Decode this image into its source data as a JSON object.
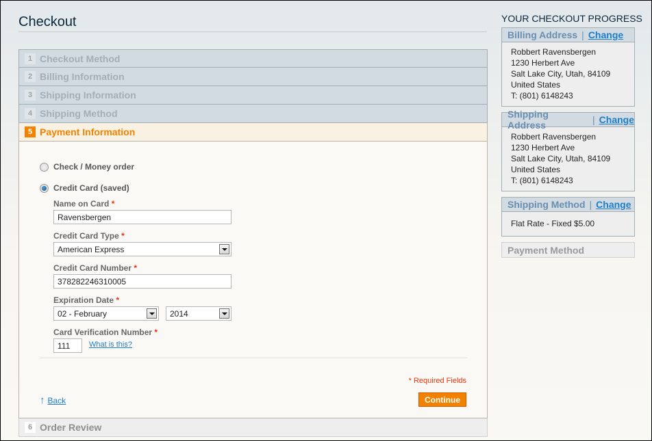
{
  "page": {
    "title": "Checkout"
  },
  "steps": [
    {
      "num": "1",
      "label": "Checkout Method"
    },
    {
      "num": "2",
      "label": "Billing Information"
    },
    {
      "num": "3",
      "label": "Shipping Information"
    },
    {
      "num": "4",
      "label": "Shipping Method"
    },
    {
      "num": "5",
      "label": "Payment Information"
    },
    {
      "num": "6",
      "label": "Order Review"
    }
  ],
  "payment": {
    "options": [
      {
        "label": "Check / Money order",
        "checked": false
      },
      {
        "label": "Credit Card (saved)",
        "checked": true
      }
    ],
    "name_label": "Name on Card",
    "name_value": "Ravensbergen",
    "type_label": "Credit Card Type",
    "type_value": "American Express",
    "number_label": "Credit Card Number",
    "number_value": "378282246310005",
    "exp_label": "Expiration Date",
    "exp_month": "02 - February",
    "exp_year": "2014",
    "cvv_label": "Card Verification Number",
    "cvv_value": "111",
    "what_is_this": "What is this?",
    "required_star": "*",
    "required_note": "* Required Fields",
    "back_label": "Back",
    "back_icon": "↑",
    "continue_label": "Continue"
  },
  "sidebar": {
    "title": "YOUR CHECKOUT PROGRESS",
    "separator": "|",
    "change_label": "Change",
    "billing": {
      "title": "Billing Address",
      "lines": [
        "Robbert Ravensbergen",
        "1230 Herbert Ave",
        "Salt Lake City, Utah, 84109",
        "United States",
        "T: (801) 6148243"
      ]
    },
    "shipping": {
      "title": "Shipping Address",
      "lines": [
        "Robbert Ravensbergen",
        "1230 Herbert Ave",
        "Salt Lake City, Utah, 84109",
        "United States",
        "T: (801) 6148243"
      ]
    },
    "method": {
      "title": "Shipping Method",
      "value": "Flat Rate - Fixed $5.00"
    },
    "payment": {
      "title": "Payment Method"
    }
  },
  "colors": {
    "accent": "#f18200",
    "link": "#1e7ec8",
    "required": "#eb340a"
  }
}
